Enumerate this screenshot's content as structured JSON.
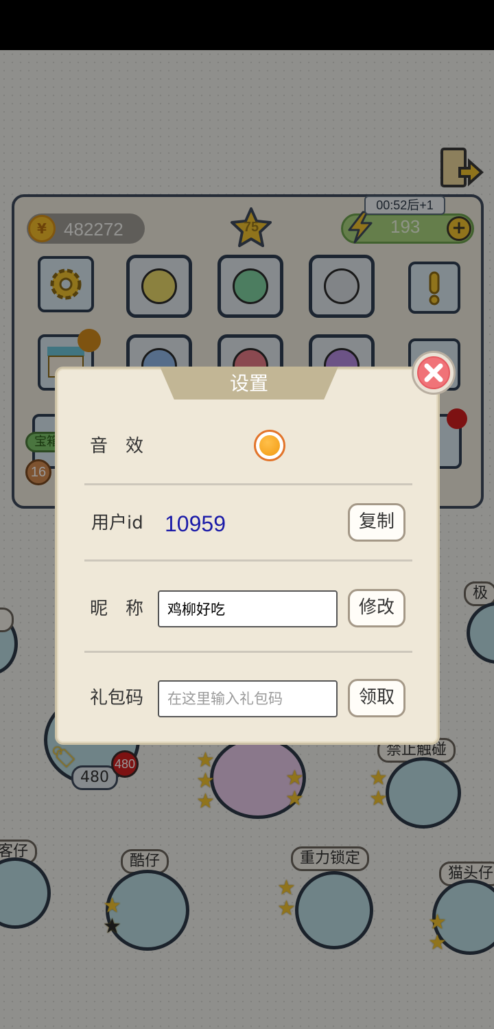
{
  "hud": {
    "coins": "482272",
    "coin_symbol": "¥",
    "stars": "75",
    "energy": "193",
    "energy_plus": "+",
    "timer": "00:52后+1",
    "badge_count": "16"
  },
  "background_skills": {
    "top_right_label": "极",
    "left_label": "客仔",
    "center_left_label": "酷仔",
    "center_right_label": "重力锁定",
    "right_label": "猫头仔",
    "forbid_label": "禁止触碰",
    "price_value": "480",
    "price_badge": "480",
    "treasure_label": "宝箱"
  },
  "modal": {
    "title": "设置",
    "sound_label": "音　效",
    "uid_label": "用户id",
    "uid_value": "10959",
    "copy_button": "复制",
    "nickname_label": "昵　称",
    "nickname_value": "鸡柳好吃",
    "modify_button": "修改",
    "giftcode_label": "礼包码",
    "giftcode_placeholder": "在这里输入礼包码",
    "claim_button": "领取"
  }
}
